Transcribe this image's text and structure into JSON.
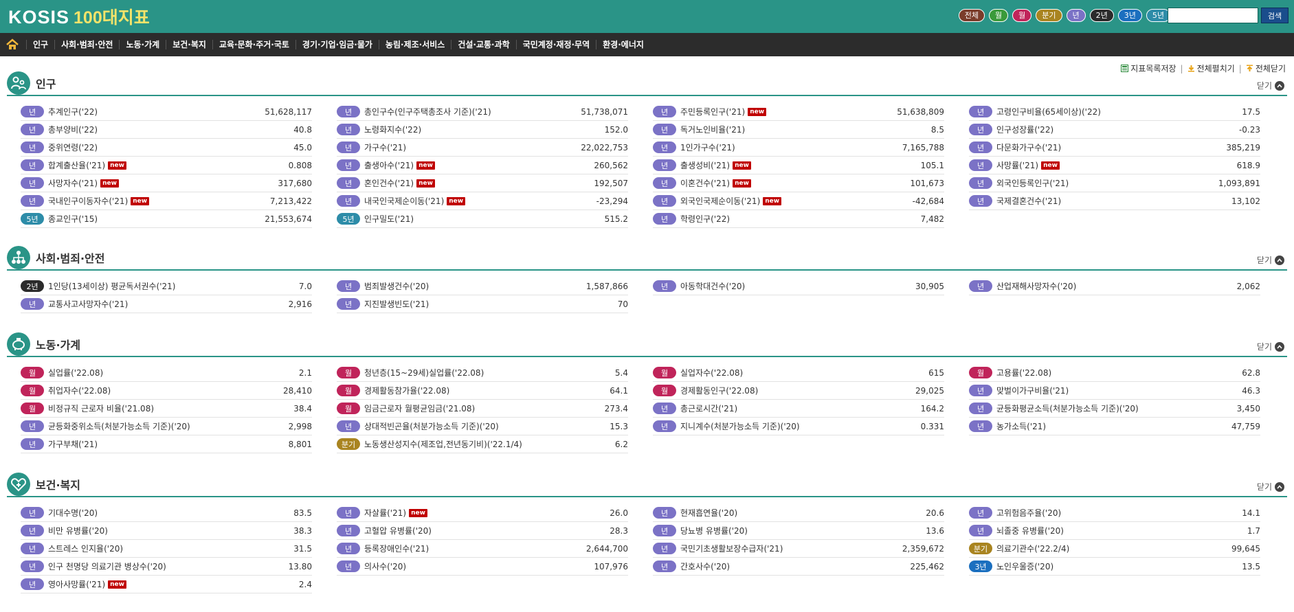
{
  "logo": {
    "kosis": "KOSIS",
    "title": "100대지표"
  },
  "filters": [
    {
      "label": "전체",
      "color": "#7a3c2a"
    },
    {
      "label": "월",
      "color": "#3a9a3a"
    },
    {
      "label": "월",
      "color": "#c0245a"
    },
    {
      "label": "분기",
      "color": "#a98420"
    },
    {
      "label": "년",
      "color": "#7b72c6"
    },
    {
      "label": "2년",
      "color": "#2b2b2b"
    },
    {
      "label": "3년",
      "color": "#1b6fbf"
    },
    {
      "label": "5년",
      "color": "#2d8ca8"
    }
  ],
  "search": {
    "placeholder": "",
    "button": "검색"
  },
  "nav": [
    "인구",
    "사회·범죄·안전",
    "노동·가계",
    "보건·복지",
    "교육·문화·주거·국토",
    "경기·기업·임금·물가",
    "농림·제조·서비스",
    "건설·교통·과학",
    "국민계정·재정·무역",
    "환경·에너지"
  ],
  "toolbar": {
    "save": "지표목록저장",
    "expand": "전체펼치기",
    "collapse": "전체닫기"
  },
  "colors": {
    "primary": "#2a9487",
    "nav": "#2c2c2c",
    "new": "#c00000"
  },
  "sections": [
    {
      "title": "인구",
      "close": "닫기",
      "icon": "people-icon",
      "columns": [
        [
          {
            "badge": "년",
            "type": "year",
            "name": "추계인구('22)",
            "value": "51,628,117"
          },
          {
            "badge": "년",
            "type": "year",
            "name": "총부양비('22)",
            "value": "40.8"
          },
          {
            "badge": "년",
            "type": "year",
            "name": "중위연령('22)",
            "value": "45.0"
          },
          {
            "badge": "년",
            "type": "year",
            "name": "합계출산율('21)",
            "new": true,
            "value": "0.808"
          },
          {
            "badge": "년",
            "type": "year",
            "name": "사망자수('21)",
            "new": true,
            "value": "317,680"
          },
          {
            "badge": "년",
            "type": "year",
            "name": "국내인구이동자수('21)",
            "new": true,
            "value": "7,213,422"
          },
          {
            "badge": "5년",
            "type": "5y",
            "name": "종교인구('15)",
            "value": "21,553,674"
          }
        ],
        [
          {
            "badge": "년",
            "type": "year",
            "name": "총인구수(인구주택총조사 기준)('21)",
            "value": "51,738,071"
          },
          {
            "badge": "년",
            "type": "year",
            "name": "노령화지수('22)",
            "value": "152.0"
          },
          {
            "badge": "년",
            "type": "year",
            "name": "가구수('21)",
            "value": "22,022,753"
          },
          {
            "badge": "년",
            "type": "year",
            "name": "출생아수('21)",
            "new": true,
            "value": "260,562"
          },
          {
            "badge": "년",
            "type": "year",
            "name": "혼인건수('21)",
            "new": true,
            "value": "192,507"
          },
          {
            "badge": "년",
            "type": "year",
            "name": "내국인국제순이동('21)",
            "new": true,
            "value": "-23,294"
          },
          {
            "badge": "5년",
            "type": "5y",
            "name": "인구밀도('21)",
            "value": "515.2"
          }
        ],
        [
          {
            "badge": "년",
            "type": "year",
            "name": "주민등록인구('21)",
            "new": true,
            "value": "51,638,809"
          },
          {
            "badge": "년",
            "type": "year",
            "name": "독거노인비율('21)",
            "value": "8.5"
          },
          {
            "badge": "년",
            "type": "year",
            "name": "1인가구수('21)",
            "value": "7,165,788"
          },
          {
            "badge": "년",
            "type": "year",
            "name": "출생성비('21)",
            "new": true,
            "value": "105.1"
          },
          {
            "badge": "년",
            "type": "year",
            "name": "이혼건수('21)",
            "new": true,
            "value": "101,673"
          },
          {
            "badge": "년",
            "type": "year",
            "name": "외국인국제순이동('21)",
            "new": true,
            "value": "-42,684"
          },
          {
            "badge": "년",
            "type": "year",
            "name": "학령인구('22)",
            "value": "7,482"
          }
        ],
        [
          {
            "badge": "년",
            "type": "year",
            "name": "고령인구비율(65세이상)('22)",
            "value": "17.5"
          },
          {
            "badge": "년",
            "type": "year",
            "name": "인구성장률('22)",
            "value": "-0.23"
          },
          {
            "badge": "년",
            "type": "year",
            "name": "다문화가구수('21)",
            "value": "385,219"
          },
          {
            "badge": "년",
            "type": "year",
            "name": "사망률('21)",
            "new": true,
            "value": "618.9"
          },
          {
            "badge": "년",
            "type": "year",
            "name": "외국인등록인구('21)",
            "value": "1,093,891"
          },
          {
            "badge": "년",
            "type": "year",
            "name": "국제결혼건수('21)",
            "value": "13,102"
          }
        ]
      ]
    },
    {
      "title": "사회·범죄·안전",
      "close": "닫기",
      "icon": "org-chart-icon",
      "columns": [
        [
          {
            "badge": "2년",
            "type": "2y",
            "name": "1인당(13세이상) 평균독서권수('21)",
            "value": "7.0"
          },
          {
            "badge": "년",
            "type": "year",
            "name": "교통사고사망자수('21)",
            "value": "2,916"
          }
        ],
        [
          {
            "badge": "년",
            "type": "year",
            "name": "범죄발생건수('20)",
            "value": "1,587,866"
          },
          {
            "badge": "년",
            "type": "year",
            "name": "지진발생빈도('21)",
            "value": "70"
          }
        ],
        [
          {
            "badge": "년",
            "type": "year",
            "name": "아동학대건수('20)",
            "value": "30,905"
          }
        ],
        [
          {
            "badge": "년",
            "type": "year",
            "name": "산업재해사망자수('20)",
            "value": "2,062"
          }
        ]
      ]
    },
    {
      "title": "노동·가계",
      "close": "닫기",
      "icon": "piggy-bank-icon",
      "columns": [
        [
          {
            "badge": "월",
            "type": "month",
            "name": "실업률('22.08)",
            "value": "2.1"
          },
          {
            "badge": "월",
            "type": "month",
            "name": "취업자수('22.08)",
            "value": "28,410"
          },
          {
            "badge": "월",
            "type": "month",
            "name": "비정규직 근로자 비율('21.08)",
            "value": "38.4"
          },
          {
            "badge": "년",
            "type": "year",
            "name": "균등화중위소득(처분가능소득 기준)('20)",
            "value": "2,998"
          },
          {
            "badge": "년",
            "type": "year",
            "name": "가구부채('21)",
            "value": "8,801"
          }
        ],
        [
          {
            "badge": "월",
            "type": "month",
            "name": "청년층(15~29세)실업률('22.08)",
            "value": "5.4"
          },
          {
            "badge": "월",
            "type": "month",
            "name": "경제활동참가율('22.08)",
            "value": "64.1"
          },
          {
            "badge": "월",
            "type": "month",
            "name": "임금근로자 월평균임금('21.08)",
            "value": "273.4"
          },
          {
            "badge": "년",
            "type": "year",
            "name": "상대적빈곤율(처분가능소득 기준)('20)",
            "value": "15.3"
          },
          {
            "badge": "분기",
            "type": "quarter",
            "name": "노동생산성지수(제조업,전년동기비)('22.1/4)",
            "value": "6.2"
          }
        ],
        [
          {
            "badge": "월",
            "type": "month",
            "name": "실업자수('22.08)",
            "value": "615"
          },
          {
            "badge": "월",
            "type": "month",
            "name": "경제활동인구('22.08)",
            "value": "29,025"
          },
          {
            "badge": "년",
            "type": "year",
            "name": "총근로시간('21)",
            "value": "164.2"
          },
          {
            "badge": "년",
            "type": "year",
            "name": "지니계수(처분가능소득 기준)('20)",
            "value": "0.331"
          }
        ],
        [
          {
            "badge": "월",
            "type": "month",
            "name": "고용률('22.08)",
            "value": "62.8"
          },
          {
            "badge": "년",
            "type": "year",
            "name": "맞벌이가구비율('21)",
            "value": "46.3"
          },
          {
            "badge": "년",
            "type": "year",
            "name": "균등화평균소득(처분가능소득 기준)('20)",
            "value": "3,450"
          },
          {
            "badge": "년",
            "type": "year",
            "name": "농가소득('21)",
            "value": "47,759"
          }
        ]
      ]
    },
    {
      "title": "보건·복지",
      "close": "닫기",
      "icon": "heart-icon",
      "columns": [
        [
          {
            "badge": "년",
            "type": "year",
            "name": "기대수명('20)",
            "value": "83.5"
          },
          {
            "badge": "년",
            "type": "year",
            "name": "비만 유병률('20)",
            "value": "38.3"
          },
          {
            "badge": "년",
            "type": "year",
            "name": "스트레스 인지율('20)",
            "value": "31.5"
          },
          {
            "badge": "년",
            "type": "year",
            "name": "인구 천명당 의료기관 병상수('20)",
            "value": "13.80"
          },
          {
            "badge": "년",
            "type": "year",
            "name": "영아사망률('21)",
            "new": true,
            "value": "2.4"
          }
        ],
        [
          {
            "badge": "년",
            "type": "year",
            "name": "자살률('21)",
            "new": true,
            "value": "26.0"
          },
          {
            "badge": "년",
            "type": "year",
            "name": "고혈압 유병률('20)",
            "value": "28.3"
          },
          {
            "badge": "년",
            "type": "year",
            "name": "등록장애인수('21)",
            "value": "2,644,700"
          },
          {
            "badge": "년",
            "type": "year",
            "name": "의사수('20)",
            "value": "107,976"
          }
        ],
        [
          {
            "badge": "년",
            "type": "year",
            "name": "현재흡연율('20)",
            "value": "20.6"
          },
          {
            "badge": "년",
            "type": "year",
            "name": "당뇨병 유병률('20)",
            "value": "13.6"
          },
          {
            "badge": "년",
            "type": "year",
            "name": "국민기초생활보장수급자('21)",
            "value": "2,359,672"
          },
          {
            "badge": "년",
            "type": "year",
            "name": "간호사수('20)",
            "value": "225,462"
          }
        ],
        [
          {
            "badge": "년",
            "type": "year",
            "name": "고위험음주율('20)",
            "value": "14.1"
          },
          {
            "badge": "년",
            "type": "year",
            "name": "뇌졸중 유병률('20)",
            "value": "1.7"
          },
          {
            "badge": "분기",
            "type": "quarter",
            "name": "의료기관수('22.2/4)",
            "value": "99,645"
          },
          {
            "badge": "3년",
            "type": "3y",
            "name": "노인우울증('20)",
            "value": "13.5"
          }
        ]
      ]
    }
  ]
}
